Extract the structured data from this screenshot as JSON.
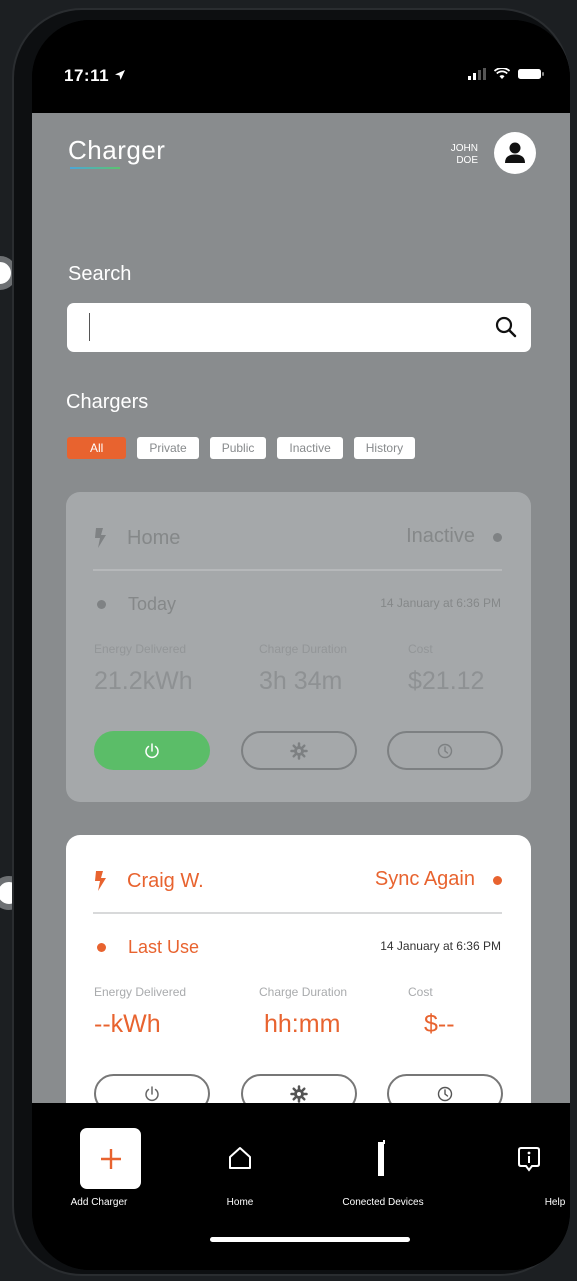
{
  "status_bar": {
    "time": "17:11"
  },
  "header": {
    "logo": "Charger",
    "user_first": "JOHN",
    "user_last": "DOE"
  },
  "search": {
    "label": "Search",
    "placeholder": ""
  },
  "chargers": {
    "title": "Chargers",
    "filters": [
      "All",
      "Private",
      "Public",
      "Inactive",
      "History"
    ],
    "active_filter": "All"
  },
  "cards": [
    {
      "name": "Home",
      "status": "Inactive",
      "sub_label": "Today",
      "timestamp": "14 January at 6:36 PM",
      "metrics": [
        {
          "label": "Energy Delivered",
          "value": "21.2kWh"
        },
        {
          "label": "Charge Duration",
          "value": "3h 34m"
        },
        {
          "label": "Cost",
          "value": "$21.12"
        }
      ],
      "power_on": true
    },
    {
      "name": "Craig W.",
      "status": "Sync Again",
      "sub_label": "Last Use",
      "timestamp": "14 January at 6:36 PM",
      "metrics": [
        {
          "label": "Energy Delivered",
          "value": "--kWh"
        },
        {
          "label": "Charge Duration",
          "value": "hh:mm"
        },
        {
          "label": "Cost",
          "value": "$--"
        }
      ],
      "power_on": false
    }
  ],
  "bottom_nav": [
    {
      "label": "Add Charger",
      "icon": "plus-icon"
    },
    {
      "label": "Home",
      "icon": "home-icon"
    },
    {
      "label": "Conected Devices",
      "icon": "device-icon"
    },
    {
      "label": "Help",
      "icon": "info-icon"
    }
  ],
  "colors": {
    "accent": "#e8632f",
    "power_on": "#5bbd68",
    "background": "#898c8e"
  }
}
